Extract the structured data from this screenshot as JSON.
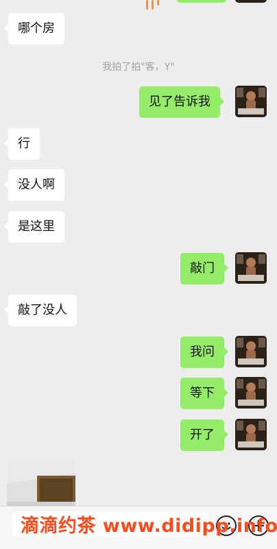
{
  "system_message": "我拍了拍\"客，Y\"",
  "messages": [
    {
      "side": "in",
      "text": "哪个房"
    },
    {
      "side": "out",
      "text": "见了告诉我"
    },
    {
      "side": "in",
      "text": "行"
    },
    {
      "side": "in",
      "text": "没人啊"
    },
    {
      "side": "in",
      "text": "是这里"
    },
    {
      "side": "out",
      "text": "敲门"
    },
    {
      "side": "in",
      "text": "敲了没人"
    },
    {
      "side": "out",
      "text": "我问"
    },
    {
      "side": "out",
      "text": "等下"
    },
    {
      "side": "out",
      "text": "开了"
    }
  ],
  "watermark": "滴滴约茶 www.didipp.info",
  "colors": {
    "background": "#ededed",
    "incoming_bubble": "#ffffff",
    "outgoing_bubble": "#95ec69",
    "watermark": "#ff4a1a"
  },
  "icons": {
    "emoji": "emoji-icon",
    "more": "plus-circle-icon"
  }
}
